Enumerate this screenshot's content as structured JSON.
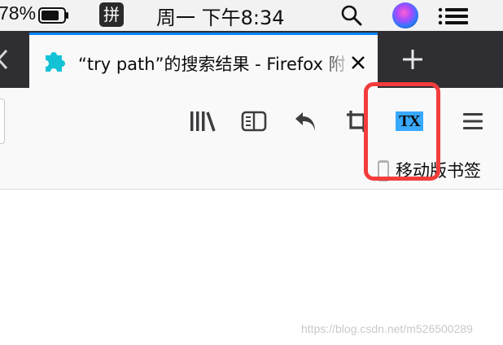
{
  "menubar": {
    "battery_percent": "78%",
    "input_method_label": "拼",
    "clock_text": "周一 下午8:34",
    "search_icon": "spotlight-search-icon",
    "siri_icon": "siri-icon",
    "control_icon": "notification-center-icon"
  },
  "tabs": {
    "active_title": "“try path”的搜索结果 - Firefox 附",
    "favicon": "puzzle-piece-icon",
    "close_icon": "close-icon",
    "new_tab_icon": "plus-icon",
    "scroll_left_icon": "chevron-left-icon",
    "accent_color": "#0a84ff",
    "tabstrip_color": "#2e2e33"
  },
  "toolbar": {
    "library_icon": "library-icon",
    "sidebar_icon": "sidebar-icon",
    "back_icon": "undo-arrow-icon",
    "crop_icon": "crop-icon",
    "extension_label": "TX",
    "extension_color": "#39a9ff",
    "menu_icon": "hamburger-menu-icon"
  },
  "bookmarks": {
    "mobile_label": "移动版书签",
    "mobile_icon": "mobile-phone-icon"
  },
  "annotation": {
    "highlight_color": "#f33c3c"
  },
  "watermark": {
    "text": "https://blog.csdn.net/m526500289"
  }
}
